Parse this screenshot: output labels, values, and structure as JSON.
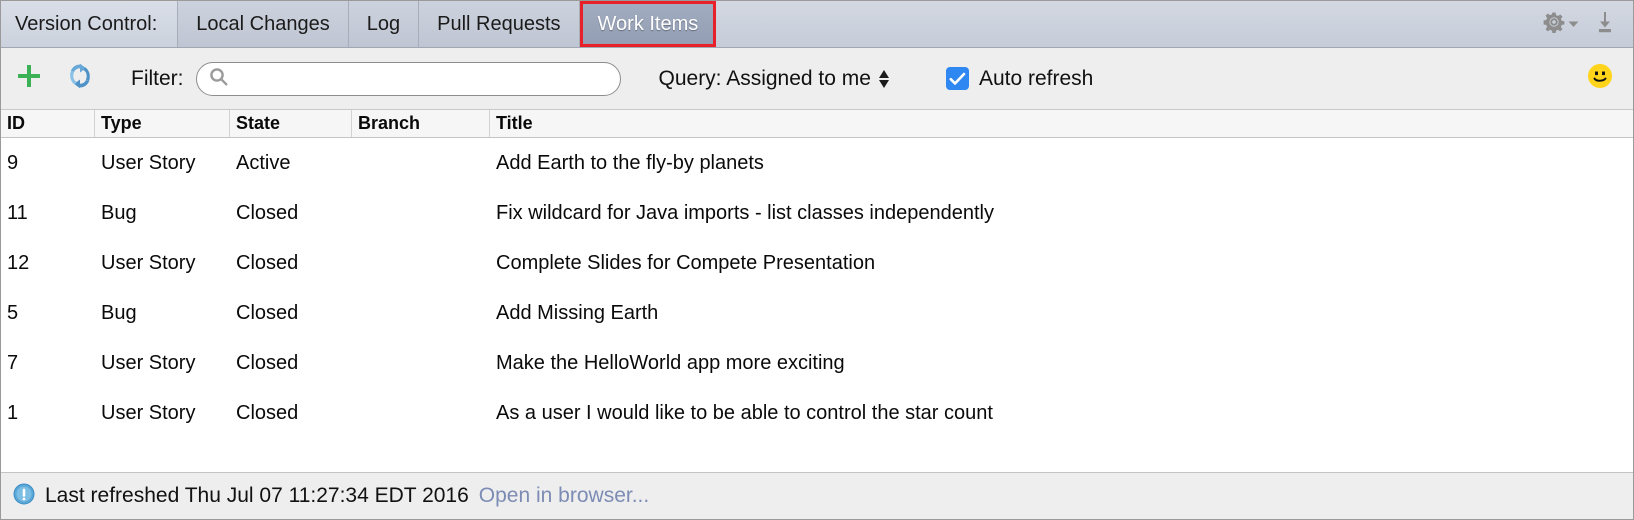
{
  "tabbar": {
    "title": "Version Control:",
    "tabs": [
      {
        "label": "Local Changes",
        "selected": false
      },
      {
        "label": "Log",
        "selected": false
      },
      {
        "label": "Pull Requests",
        "selected": false
      },
      {
        "label": "Work Items",
        "selected": true
      }
    ],
    "icons": {
      "settings": "gear-icon",
      "settings_chevron": "chevron-down-icon",
      "hide": "hide-panel-icon"
    },
    "selected_highlight_color": "#e8202a"
  },
  "toolbar": {
    "add_icon": "plus-icon",
    "refresh_icon": "refresh-icon",
    "filter_label": "Filter:",
    "search": {
      "icon": "search-icon",
      "value": "",
      "placeholder": ""
    },
    "query": {
      "label": "Query: Assigned to me",
      "stepper_icon": "updown-stepper-icon"
    },
    "auto_refresh": {
      "label": "Auto refresh",
      "checked": true,
      "check_color": "#2f87f2"
    },
    "smiley_icon": "smiley-face-icon"
  },
  "table": {
    "columns": [
      "ID",
      "Type",
      "State",
      "Branch",
      "Title"
    ],
    "rows": [
      {
        "id": "9",
        "type": "User Story",
        "state": "Active",
        "branch": "",
        "title": "Add Earth to the fly-by planets"
      },
      {
        "id": "11",
        "type": "Bug",
        "state": "Closed",
        "branch": "",
        "title": "Fix wildcard for Java imports - list classes independently"
      },
      {
        "id": "12",
        "type": "User Story",
        "state": "Closed",
        "branch": "",
        "title": "Complete Slides for Compete Presentation"
      },
      {
        "id": "5",
        "type": "Bug",
        "state": "Closed",
        "branch": "",
        "title": "Add Missing Earth"
      },
      {
        "id": "7",
        "type": "User Story",
        "state": "Closed",
        "branch": "",
        "title": "Make the HelloWorld app more exciting"
      },
      {
        "id": "1",
        "type": "User Story",
        "state": "Closed",
        "branch": "",
        "title": "As a user I would like to be able to control the star count"
      }
    ]
  },
  "statusbar": {
    "icon": "info-icon",
    "message": "Last refreshed Thu Jul 07 11:27:34 EDT 2016",
    "link": "Open in browser...",
    "link_color": "#7d8cb5"
  }
}
